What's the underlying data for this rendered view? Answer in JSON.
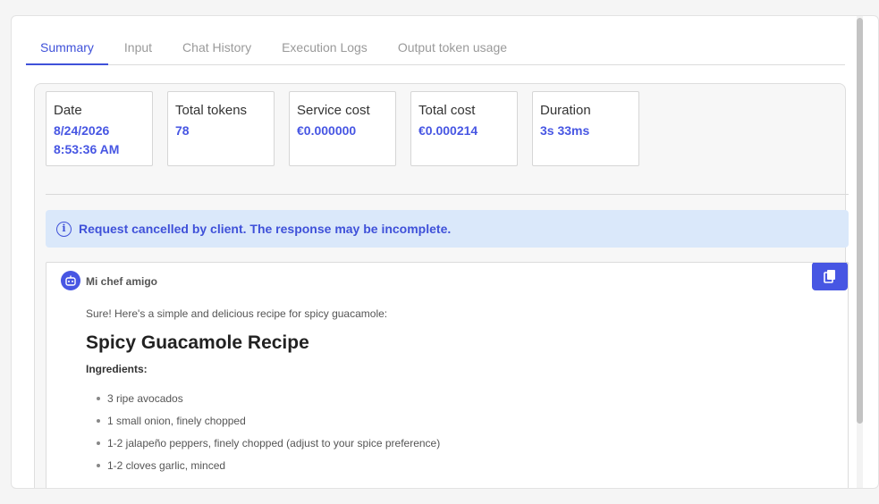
{
  "tabs": [
    {
      "label": "Summary",
      "active": true
    },
    {
      "label": "Input",
      "active": false
    },
    {
      "label": "Chat History",
      "active": false
    },
    {
      "label": "Execution Logs",
      "active": false
    },
    {
      "label": "Output token usage",
      "active": false
    }
  ],
  "stats": {
    "date": {
      "label": "Date",
      "value_line1": "8/24/2026",
      "value_line2": "8:53:36 AM"
    },
    "total_tokens": {
      "label": "Total tokens",
      "value": "78"
    },
    "service_cost": {
      "label": "Service cost",
      "value": "€0.000000"
    },
    "total_cost": {
      "label": "Total cost",
      "value": "€0.000214"
    },
    "duration": {
      "label": "Duration",
      "value": "3s 33ms"
    }
  },
  "alert": {
    "icon": "info-icon",
    "text": "Request cancelled by client. The response may be incomplete."
  },
  "message": {
    "sender": "Mi chef amigo",
    "avatar_icon": "robot-icon",
    "copy_icon": "copy-icon",
    "intro": "Sure! Here's a simple and delicious recipe for spicy guacamole:",
    "title": "Spicy Guacamole Recipe",
    "ingredients_heading": "Ingredients:",
    "ingredients": [
      "3 ripe avocados",
      "1 small onion, finely chopped",
      "1-2 jalapeño peppers, finely chopped (adjust to your spice preference)",
      "1-2 cloves garlic, minced"
    ]
  },
  "colors": {
    "accent": "#4756e3",
    "alert_bg": "#dae8fa"
  }
}
